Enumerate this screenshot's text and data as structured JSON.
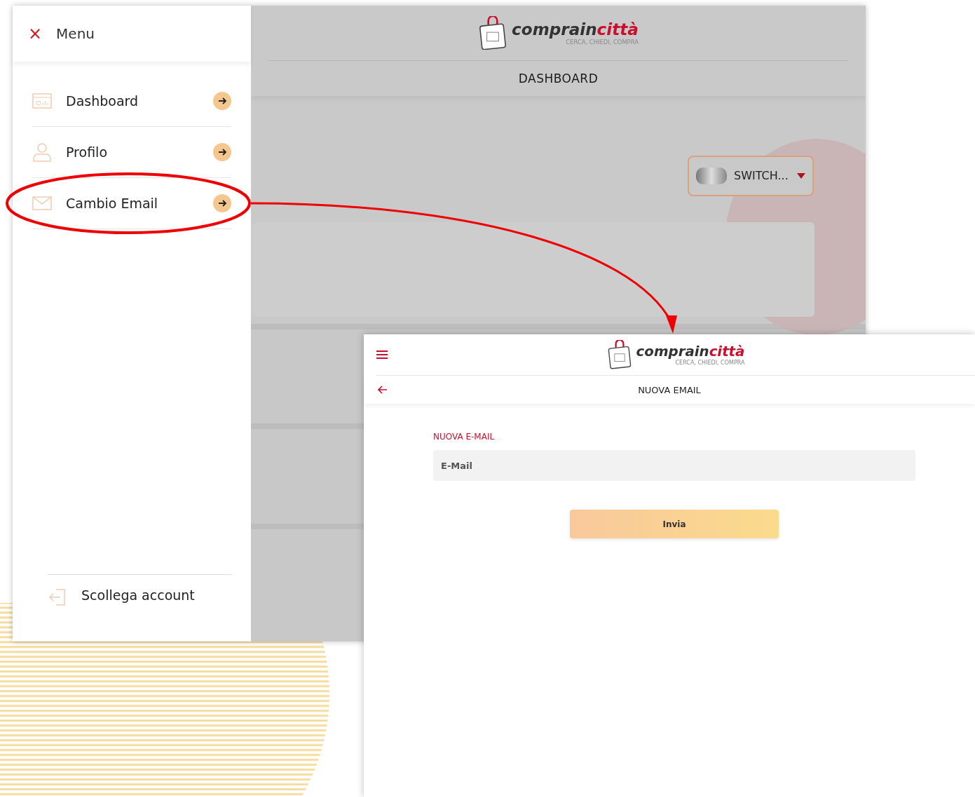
{
  "dashboard_screen": {
    "menu": {
      "close_icon": "×",
      "title": "Menu",
      "items": [
        {
          "label": "Dashboard"
        },
        {
          "label": "Profilo"
        },
        {
          "label": "Cambio Email"
        }
      ],
      "logout": "Scollega account"
    },
    "logo": {
      "brand_dark": "comprain",
      "brand_red": "città",
      "tagline": "CERCA, CHIEDI, COMPRA"
    },
    "page_title": "DASHBOARD",
    "switch_button": "SWITCH..."
  },
  "email_screen": {
    "logo": {
      "brand_dark": "comprain",
      "brand_red": "città",
      "tagline": "CERCA, CHIEDI, COMPRA"
    },
    "page_title": "NUOVA EMAIL",
    "field_label": "NUOVA E-MAIL",
    "email_field": {
      "placeholder": "E-Mail"
    },
    "submit_button": "Invia"
  }
}
